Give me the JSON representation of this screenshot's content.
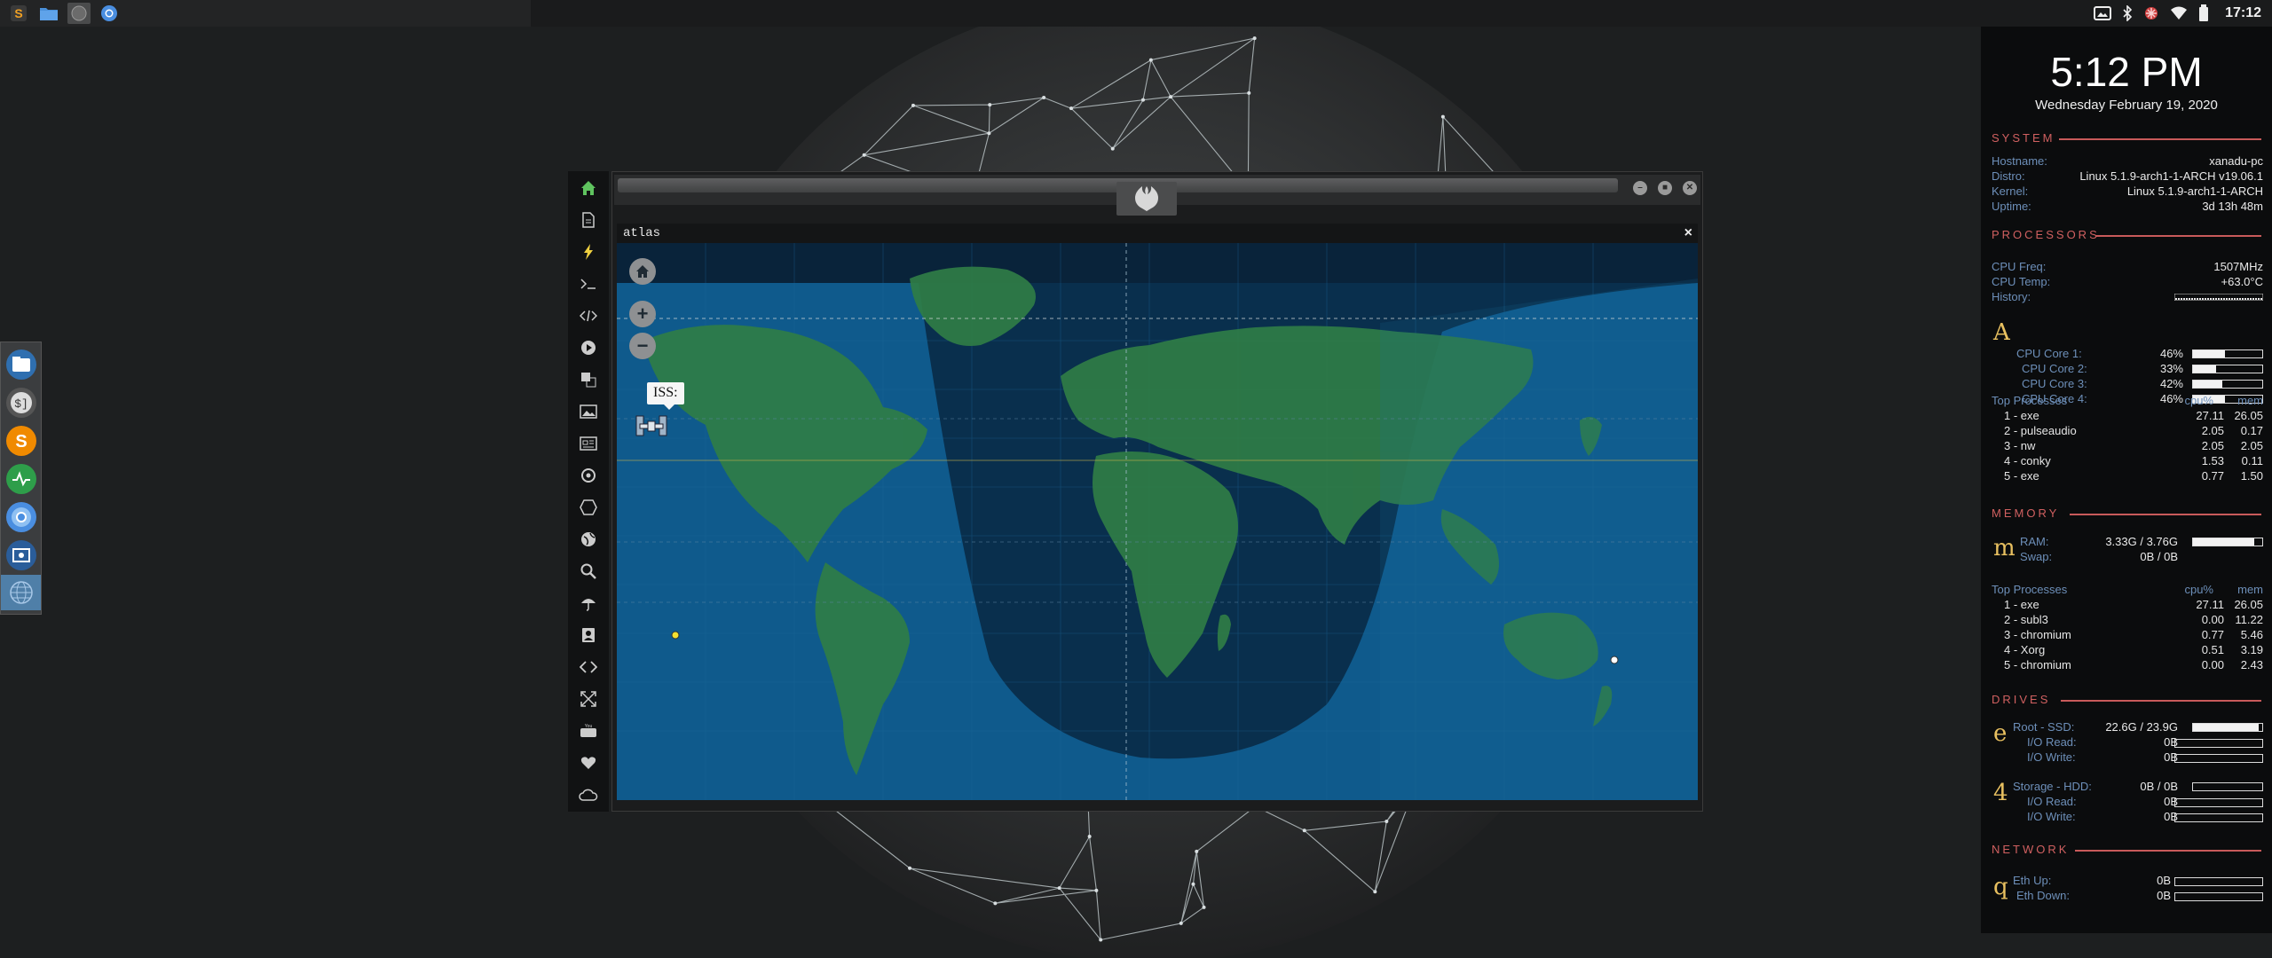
{
  "taskbar": {
    "apps": [
      {
        "name": "sublime-text",
        "icon": "sublime-icon",
        "color": "#f0a024"
      },
      {
        "name": "files",
        "icon": "folder-icon",
        "color": "#4a90d9"
      },
      {
        "name": "atlas",
        "icon": "globe-icon",
        "color": "#6b6b6b",
        "active": true
      },
      {
        "name": "chromium",
        "icon": "chromium-icon",
        "color": "#4a8ee0"
      }
    ],
    "clock": "17:12"
  },
  "dock": {
    "items": [
      "files-icon",
      "terminal-icon",
      "sublime-icon",
      "system-monitor-icon",
      "chromium-icon",
      "screenshot-icon",
      "globe-icon"
    ]
  },
  "launcher": {
    "icons": [
      "home-icon",
      "document-icon",
      "lightning-icon",
      "terminal-icon",
      "code-icon",
      "play-icon",
      "translate-icon",
      "image-icon",
      "news-icon",
      "settings-icon",
      "hexagon-icon",
      "globe-icon",
      "search-icon",
      "umbrella-icon",
      "contacts-icon",
      "transfer-icon",
      "fullscreen-icon",
      "youtube-icon",
      "heart-icon",
      "cloud-icon"
    ]
  },
  "window": {
    "app_title": "atlas",
    "close_label": "×",
    "iss_label": "ISS:",
    "zoom_in": "+",
    "zoom_out": "−"
  },
  "conky": {
    "time": "5:12 PM",
    "date": "Wednesday February 19, 2020",
    "system": {
      "header": "SYSTEM",
      "rows": [
        {
          "k": "Hostname:",
          "v": "xanadu-pc"
        },
        {
          "k": "Distro:",
          "v": "Linux 5.1.9-arch1-1-ARCH v19.06.1"
        },
        {
          "k": "Kernel:",
          "v": "Linux 5.1.9-arch1-1-ARCH"
        },
        {
          "k": "Uptime:",
          "v": "3d 13h 48m"
        }
      ]
    },
    "processors": {
      "header": "PROCESSORS",
      "rows": [
        {
          "k": "CPU Freq:",
          "v": "1507MHz"
        },
        {
          "k": "CPU Temp:",
          "v": "+63.0°C"
        },
        {
          "k": "History:",
          "v": ""
        }
      ],
      "letter": "A",
      "cores": [
        {
          "k": "CPU Core 1:",
          "v": "46%",
          "level": 0.46
        },
        {
          "k": "CPU Core 2:",
          "v": "33%",
          "level": 0.33
        },
        {
          "k": "CPU Core 3:",
          "v": "42%",
          "level": 0.42
        },
        {
          "k": "CPU Core 4:",
          "v": "46%",
          "level": 0.46
        }
      ],
      "top_title": "Top Processes",
      "col_cpu": "cpu%",
      "col_mem": "mem",
      "procs": [
        {
          "n": "1 - exe",
          "cpu": "27.11",
          "mem": "26.05"
        },
        {
          "n": "2 - pulseaudio",
          "cpu": "2.05",
          "mem": "0.17"
        },
        {
          "n": "3 - nw",
          "cpu": "2.05",
          "mem": "2.05"
        },
        {
          "n": "4 - conky",
          "cpu": "1.53",
          "mem": "0.11"
        },
        {
          "n": "5 - exe",
          "cpu": "0.77",
          "mem": "1.50"
        }
      ]
    },
    "memory": {
      "header": "MEMORY",
      "letter": "m",
      "ram_k": "RAM:",
      "ram_v": "3.33G / 3.76G",
      "ram_level": 0.89,
      "swap_k": "Swap:",
      "swap_v": "0B / 0B",
      "top_title": "Top Processes",
      "col_cpu": "cpu%",
      "col_mem": "mem",
      "procs": [
        {
          "n": "1 - exe",
          "cpu": "27.11",
          "mem": "26.05"
        },
        {
          "n": "2 - subl3",
          "cpu": "0.00",
          "mem": "11.22"
        },
        {
          "n": "3 - chromium",
          "cpu": "0.77",
          "mem": "5.46"
        },
        {
          "n": "4 - Xorg",
          "cpu": "0.51",
          "mem": "3.19"
        },
        {
          "n": "5 - chromium",
          "cpu": "0.00",
          "mem": "2.43"
        }
      ]
    },
    "drives": {
      "header": "DRIVES",
      "root": {
        "letter": "e",
        "k": "Root  -  SSD:",
        "v": "22.6G / 23.9G",
        "level": 0.95,
        "read_k": "I/O Read:",
        "read_v": "0B",
        "write_k": "I/O Write:",
        "write_v": "0B"
      },
      "storage": {
        "letter": "4",
        "k": "Storage  -  HDD:",
        "v": "0B / 0B",
        "level": 0,
        "read_k": "I/O Read:",
        "read_v": "0B",
        "write_k": "I/O Write:",
        "write_v": "0B"
      }
    },
    "network": {
      "header": "NETWORK",
      "letter": "q",
      "up_k": "Eth Up:",
      "up_v": "0B",
      "down_k": "Eth Down:",
      "down_v": "0B"
    }
  }
}
